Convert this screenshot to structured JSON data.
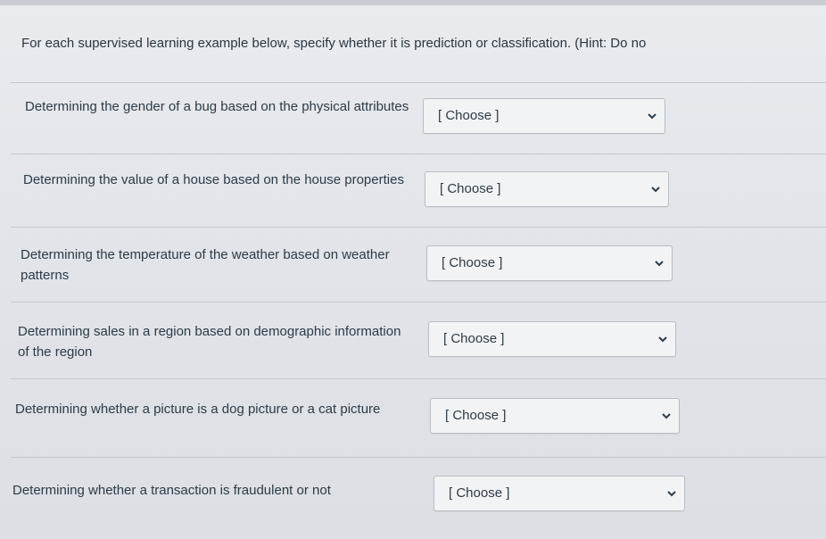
{
  "instructions": "For each supervised learning example below, specify whether it is prediction or classification. (Hint: Do no",
  "questions": [
    {
      "text": "Determining the gender of a bug based on the physical attributes",
      "selected": "[ Choose ]"
    },
    {
      "text": "Determining the value of a house based on the house properties",
      "selected": "[ Choose ]"
    },
    {
      "text": "Determining the temperature of the weather based on weather patterns",
      "selected": "[ Choose ]"
    },
    {
      "text": "Determining sales in a region based on demographic information of the region",
      "selected": "[ Choose ]"
    },
    {
      "text": "Determining whether a picture is a dog picture or a cat picture",
      "selected": "[ Choose ]"
    },
    {
      "text": "Determining whether a transaction is fraudulent or not",
      "selected": "[ Choose ]"
    }
  ],
  "icons": {
    "dropdown": "chevron-down-icon"
  }
}
